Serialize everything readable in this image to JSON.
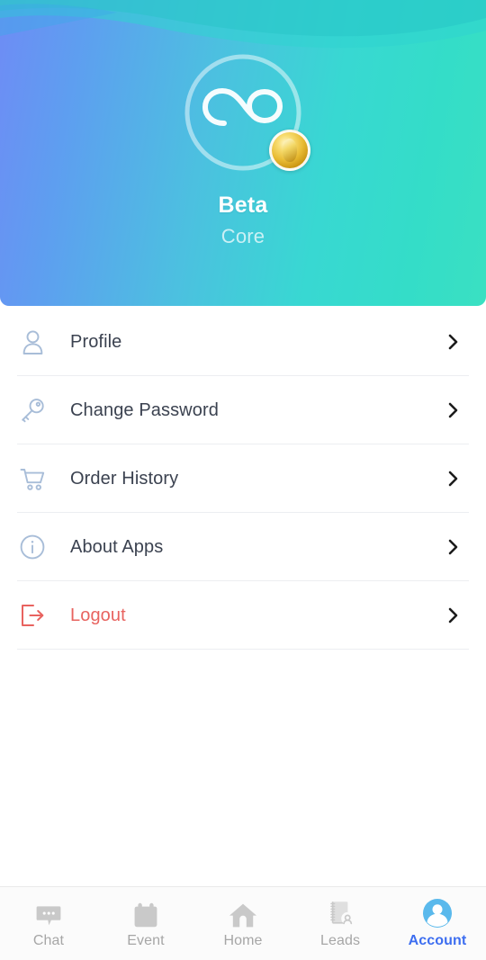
{
  "header": {
    "avatar_icon": "infinity-loop-icon",
    "badge_icon": "gold-coin-badge-icon",
    "name": "Beta",
    "subtitle": "Core",
    "gradient_from": "#6e8cf5",
    "gradient_to": "#3ae0c2",
    "wave_color": "#2fd3d0"
  },
  "menu": {
    "items": [
      {
        "label": "Profile",
        "icon": "user-icon",
        "chevron": "chevron-right-icon",
        "style": "normal"
      },
      {
        "label": "Change Password",
        "icon": "key-icon",
        "chevron": "chevron-right-icon",
        "style": "normal"
      },
      {
        "label": "Order History",
        "icon": "cart-icon",
        "chevron": "chevron-right-icon",
        "style": "normal"
      },
      {
        "label": "About Apps",
        "icon": "info-icon",
        "chevron": "chevron-right-icon",
        "style": "normal"
      },
      {
        "label": "Logout",
        "icon": "logout-icon",
        "chevron": "chevron-right-icon",
        "style": "danger"
      }
    ],
    "icon_color": "#a8bdd8",
    "danger_color": "#e8635f",
    "text_color": "#3b4250",
    "divider_color": "#eceef1"
  },
  "tabbar": {
    "active_color": "#3d6ef0",
    "inactive_color": "#a6a6a6",
    "items": [
      {
        "label": "Chat",
        "icon": "chat-bubble-icon",
        "active": false
      },
      {
        "label": "Event",
        "icon": "calendar-icon",
        "active": false
      },
      {
        "label": "Home",
        "icon": "home-icon",
        "active": false
      },
      {
        "label": "Leads",
        "icon": "notebook-person-icon",
        "active": false
      },
      {
        "label": "Account",
        "icon": "account-circle-icon",
        "active": true
      }
    ]
  }
}
